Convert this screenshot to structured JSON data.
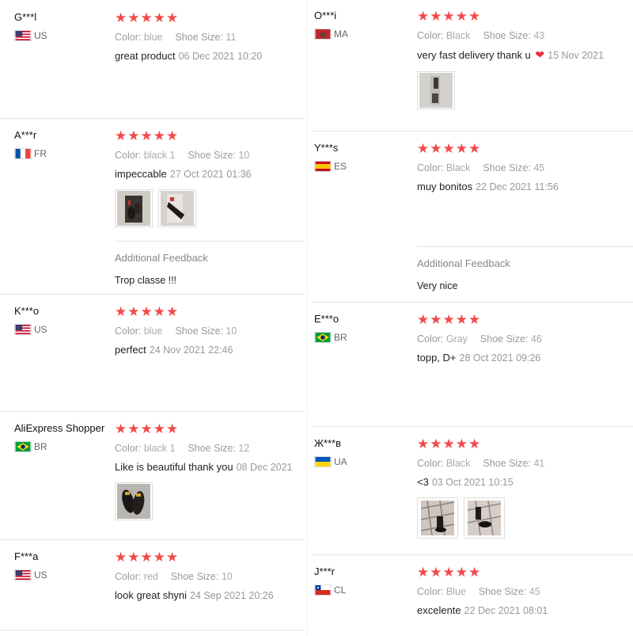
{
  "reviews_left": [
    {
      "name": "G***l",
      "country": "US",
      "flag": "us",
      "stars": "★★★★★",
      "color_label": "Color:",
      "color": "blue",
      "size_label": "Shoe Size:",
      "size": "11",
      "text": "great product",
      "date": "06 Dec 2021 10:20",
      "photos": []
    },
    {
      "name": "A***r",
      "country": "FR",
      "flag": "fr",
      "stars": "★★★★★",
      "color_label": "Color:",
      "color": "black 1",
      "size_label": "Shoe Size:",
      "size": "10",
      "text": "impeccable",
      "date": "27 Oct 2021 01:36",
      "photos": [
        "shoe-photo",
        "shoe-photo"
      ],
      "additional_label": "Additional Feedback",
      "additional_text": "Trop classe !!!"
    },
    {
      "name": "K***o",
      "country": "US",
      "flag": "us",
      "stars": "★★★★★",
      "color_label": "Color:",
      "color": "blue",
      "size_label": "Shoe Size:",
      "size": "10",
      "text": "perfect",
      "date": "24 Nov 2021 22:46",
      "photos": []
    },
    {
      "name": "AliExpress Shopper",
      "country": "BR",
      "flag": "br",
      "stars": "★★★★★",
      "color_label": "Color:",
      "color": "black 1",
      "size_label": "Shoe Size:",
      "size": "12",
      "text": "Like is beautiful thank you",
      "date": "08 Dec 2021",
      "photos": [
        "shoe-photo"
      ]
    },
    {
      "name": "F***a",
      "country": "US",
      "flag": "us",
      "stars": "★★★★★",
      "color_label": "Color:",
      "color": "red",
      "size_label": "Shoe Size:",
      "size": "10",
      "text": "look great shyni",
      "date": "24 Sep 2021 20:26",
      "photos": []
    }
  ],
  "reviews_right": [
    {
      "name": "O***i",
      "country": "MA",
      "flag": "ma",
      "stars": "★★★★★",
      "color_label": "Color:",
      "color": "Black",
      "size_label": "Shoe Size:",
      "size": "43",
      "text": "very fast delivery thank u",
      "heart": "❤",
      "date": "15 Nov 2021",
      "photos": [
        "shoe-photo"
      ]
    },
    {
      "name": "Y***s",
      "country": "ES",
      "flag": "es",
      "stars": "★★★★★",
      "color_label": "Color:",
      "color": "Black",
      "size_label": "Shoe Size:",
      "size": "45",
      "text": "muy bonitos",
      "date": "22 Dec 2021 11:56",
      "photos": [],
      "additional_label": "Additional Feedback",
      "additional_text": "Very nice"
    },
    {
      "name": "E***o",
      "country": "BR",
      "flag": "br",
      "stars": "★★★★★",
      "color_label": "Color:",
      "color": "Gray",
      "size_label": "Shoe Size:",
      "size": "46",
      "text": "topp, D+",
      "date": "28 Oct 2021 09:26",
      "photos": []
    },
    {
      "name": "Ж***в",
      "country": "UA",
      "flag": "ua",
      "stars": "★★★★★",
      "color_label": "Color:",
      "color": "Black",
      "size_label": "Shoe Size:",
      "size": "41",
      "text": "<3",
      "date": "03 Oct 2021 10:15",
      "photos": [
        "shoe-photo",
        "shoe-photo"
      ]
    },
    {
      "name": "J***r",
      "country": "CL",
      "flag": "cl",
      "stars": "★★★★★",
      "color_label": "Color:",
      "color": "Blue",
      "size_label": "Shoe Size:",
      "size": "45",
      "text": "excelente",
      "date": "22 Dec 2021 08:01",
      "photos": []
    }
  ],
  "colors": {
    "star": "#f24a4a",
    "heart": "#e0323b",
    "muted": "#9a9a9a"
  }
}
